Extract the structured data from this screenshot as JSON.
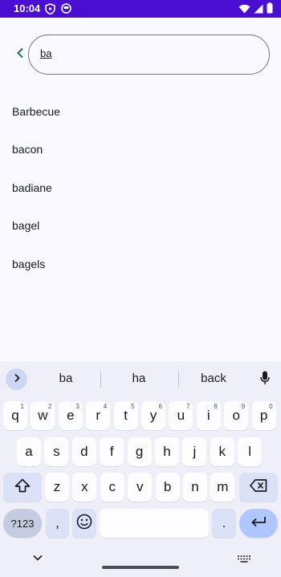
{
  "status_bar": {
    "time": "10:04"
  },
  "search": {
    "query": "ba"
  },
  "results": [
    "Barbecue",
    "bacon",
    "badiane",
    "bagel",
    "bagels"
  ],
  "keyboard": {
    "suggestions": [
      "ba",
      "ha",
      "back"
    ],
    "row1": [
      {
        "label": "q",
        "hint": "1"
      },
      {
        "label": "w",
        "hint": "2"
      },
      {
        "label": "e",
        "hint": "3"
      },
      {
        "label": "r",
        "hint": "4"
      },
      {
        "label": "t",
        "hint": "5"
      },
      {
        "label": "y",
        "hint": "6"
      },
      {
        "label": "u",
        "hint": "7"
      },
      {
        "label": "i",
        "hint": "8"
      },
      {
        "label": "o",
        "hint": "9"
      },
      {
        "label": "p",
        "hint": "0"
      }
    ],
    "row2": [
      "a",
      "s",
      "d",
      "f",
      "g",
      "h",
      "j",
      "k",
      "l"
    ],
    "row3": [
      "z",
      "x",
      "c",
      "v",
      "b",
      "n",
      "m"
    ],
    "symbols_label": "?123",
    "comma_label": ",",
    "period_label": "."
  },
  "colors": {
    "status_bar": "#4a0ed3",
    "accent": "#1f6b7a",
    "enter_key": "#afc6ff"
  }
}
